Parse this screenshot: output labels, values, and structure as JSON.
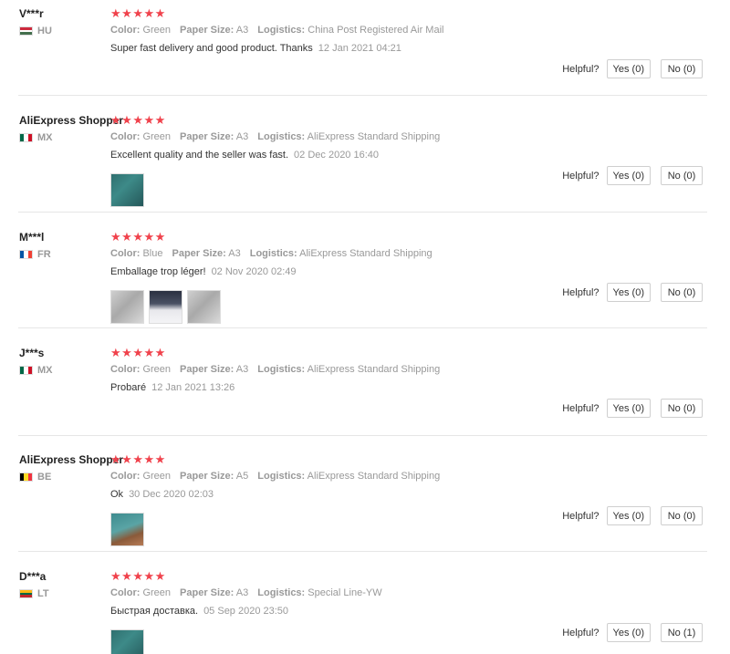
{
  "helpful_label": "Helpful?",
  "attr_labels": {
    "color": "Color:",
    "paper_size": "Paper Size:",
    "logistics": "Logistics:"
  },
  "accent_color": "#f0424c",
  "star_icon": "★",
  "reviews": [
    {
      "user": "V***r",
      "country": "HU",
      "flag_colors": [
        "#cd2a3e",
        "#ffffff",
        "#436f4d"
      ],
      "flag_dir": "horizontal",
      "rating": 5,
      "color": "Green",
      "paper_size": "A3",
      "logistics": "China Post Registered Air Mail",
      "text": "Super fast delivery and good product. Thanks",
      "date": "12 Jan 2021 04:21",
      "images": [],
      "yes": "Yes (0)",
      "no": "No (0)"
    },
    {
      "user": "AliExpress Shopper",
      "country": "MX",
      "flag_colors": [
        "#006847",
        "#ffffff",
        "#ce1126"
      ],
      "flag_dir": "vertical",
      "rating": 5,
      "color": "Green",
      "paper_size": "A3",
      "logistics": "AliExpress Standard Shipping",
      "text": "Excellent quality and the seller was fast.",
      "date": "02 Dec 2020 16:40",
      "images": [
        "teal-photo"
      ],
      "yes": "Yes (0)",
      "no": "No (0)"
    },
    {
      "user": "M***l",
      "country": "FR",
      "flag_colors": [
        "#0055a4",
        "#ffffff",
        "#ef4135"
      ],
      "flag_dir": "vertical",
      "rating": 5,
      "color": "Blue",
      "paper_size": "A3",
      "logistics": "AliExpress Standard Shipping",
      "text": "Emballage trop léger!",
      "date": "02 Nov 2020 02:49",
      "images": [
        "grey-photo",
        "dark-photo",
        "grey-photo"
      ],
      "yes": "Yes (0)",
      "no": "No (0)"
    },
    {
      "user": "J***s",
      "country": "MX",
      "flag_colors": [
        "#006847",
        "#ffffff",
        "#ce1126"
      ],
      "flag_dir": "vertical",
      "rating": 5,
      "color": "Green",
      "paper_size": "A3",
      "logistics": "AliExpress Standard Shipping",
      "text": "Probaré",
      "date": "12 Jan 2021 13:26",
      "images": [],
      "yes": "Yes (0)",
      "no": "No (0)"
    },
    {
      "user": "AliExpress Shopper",
      "country": "BE",
      "flag_colors": [
        "#000000",
        "#fdda24",
        "#ef3340"
      ],
      "flag_dir": "vertical",
      "rating": 5,
      "color": "Green",
      "paper_size": "A5",
      "logistics": "AliExpress Standard Shipping",
      "text": "Ok",
      "date": "30 Dec 2020 02:03",
      "images": [
        "teal-brown-photo"
      ],
      "yes": "Yes (0)",
      "no": "No (0)"
    },
    {
      "user": "D***a",
      "country": "LT",
      "flag_colors": [
        "#fdb913",
        "#006a44",
        "#c1272d"
      ],
      "flag_dir": "horizontal",
      "rating": 5,
      "color": "Green",
      "paper_size": "A3",
      "logistics": "Special Line-YW",
      "text": "Быстрая доставка.",
      "date": "05 Sep 2020 23:50",
      "images": [
        "teal-photo"
      ],
      "yes": "Yes (0)",
      "no": "No (1)"
    }
  ]
}
